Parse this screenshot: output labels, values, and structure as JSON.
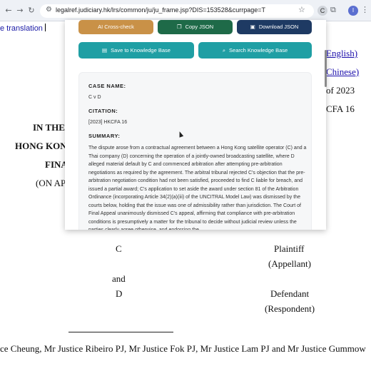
{
  "browser": {
    "url": "legalref.judiciary.hk/lrs/common/ju/ju_frame.jsp?DIS=153528&currpage=T",
    "ext_letter": "C",
    "profile_letter": "I"
  },
  "page": {
    "translation_label": "e translation",
    "link_english": "English)",
    "link_chinese": "Chinese)",
    "of_year": "of 2023",
    "cfa_no": "CFA 16",
    "in_the": "IN THE",
    "hong_kong": "HONG KON",
    "final": "FINA",
    "on_appeal": "(ON AP",
    "party_c": "C",
    "plaintiff": "Plaintiff",
    "appellant": "(Appellant)",
    "and": "and",
    "party_d": "D",
    "defendant": "Defendant",
    "respondent": "(Respondent)",
    "coram": "ce Cheung, Mr Justice Ribeiro PJ, Mr Justice Fok PJ, Mr Justice Lam PJ and Mr Justice Gummow"
  },
  "panel": {
    "buttons": {
      "ai_crosscheck": "AI Cross-check",
      "copy_json": "Copy JSON",
      "download_json": "Download JSON",
      "save_kb": "Save to Knowledge Base",
      "search_kb": "Search Knowledge Base"
    },
    "case": {
      "case_name_label": "CASE NAME:",
      "case_name": "C v D",
      "citation_label": "CITATION:",
      "citation": "[2023] HKCFA 16",
      "summary_label": "SUMMARY:",
      "summary": "The dispute arose from a contractual agreement between a Hong Kong satellite operator (C) and a Thai company (D) concerning the operation of a jointly-owned broadcasting satellite, where D alleged material default by C and commenced arbitration after attempting pre-arbitration negotiations as required by the agreement. The arbitral tribunal rejected C's objection that the pre-arbitration negotiation condition had not been satisfied, proceeded to find C liable for breach, and issued a partial award; C's application to set aside the award under section 81 of the Arbitration Ordinance (incorporating Article 34(2)(a)(iii) of the UNCITRAL Model Law) was dismissed by the courts below, holding that the issue was one of admissibility rather than jurisdiction. The Court of Final Appeal unanimously dismissed C's appeal, affirming that compliance with pre-arbitration conditions is presumptively a matter for the tribunal to decide without judicial review unless the parties clearly agree otherwise, and endorsing the"
    }
  },
  "colors": {
    "ai_button": "#c99147",
    "copy_button": "#1e6a48",
    "download_button": "#1e3a63",
    "kb_buttons": "#1f9fa4"
  }
}
